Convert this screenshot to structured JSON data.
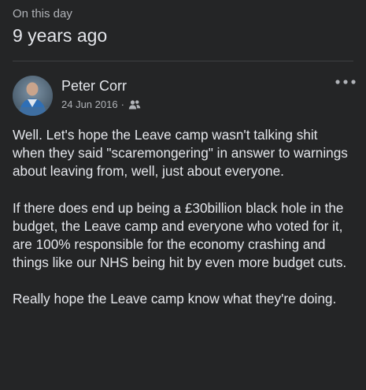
{
  "memory": {
    "label": "On this day",
    "title": "9 years ago"
  },
  "post": {
    "author": "Peter Corr",
    "date": "24 Jun 2016",
    "separator": "·",
    "audience_icon": "friends-icon",
    "more_icon": "more-options-icon",
    "paragraphs": [
      "Well.  Let's hope the Leave camp wasn't talking shit when they said \"scaremongering\" in answer to warnings about leaving from, well, just about everyone.",
      "If there does end up being a £30billion black hole in the budget, the Leave camp and everyone who voted for it, are 100% responsible for the economy crashing and things like our NHS being hit by even more budget cuts.",
      "Really hope the Leave camp know what they're doing."
    ]
  },
  "colors": {
    "background": "#242526",
    "primary_text": "#e4e6eb",
    "secondary_text": "#b0b3b8",
    "divider": "#3e4042"
  }
}
